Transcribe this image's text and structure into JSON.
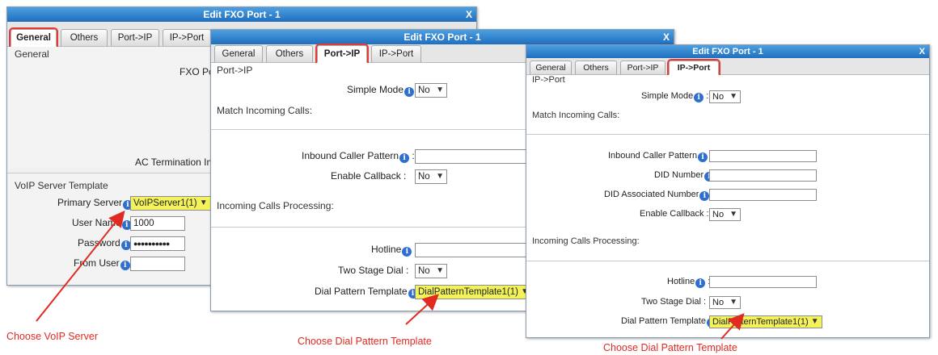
{
  "dialog1": {
    "title": "Edit FXO Port - 1",
    "close": "X",
    "tabs": [
      {
        "label": "General",
        "active": true
      },
      {
        "label": "Others",
        "active": false
      },
      {
        "label": "Port->IP",
        "active": false
      },
      {
        "label": "IP->Port",
        "active": false
      }
    ],
    "section_general": "General",
    "fxo_label": "FXO Por",
    "ac_label": "AC Termination Imp",
    "section_voip": "VoIP Server Template",
    "primary_server_label": "Primary Server",
    "primary_server_value": "VoIPServer1(1)",
    "username_label": "User Name",
    "username_value": "1000",
    "password_label": "Password",
    "password_value": "●●●●●●●●●●",
    "fromuser_label": "From User",
    "fromuser_value": ""
  },
  "dialog2": {
    "title": "Edit FXO Port - 1",
    "close": "X",
    "tabs": [
      {
        "label": "General",
        "active": false
      },
      {
        "label": "Others",
        "active": false
      },
      {
        "label": "Port->IP",
        "active": true
      },
      {
        "label": "IP->Port",
        "active": false
      }
    ],
    "section": "Port->IP",
    "simple_mode_label": "Simple Mode",
    "simple_mode_value": "No",
    "match_incoming": "Match Incoming Calls:",
    "inbound_caller_label": "Inbound Caller Pattern",
    "inbound_caller_value": "",
    "enable_callback_label": "Enable Callback :",
    "enable_callback_value": "No",
    "incoming_processing": "Incoming Calls Processing:",
    "hotline_label": "Hotline",
    "hotline_value": "",
    "two_stage_label": "Two Stage Dial :",
    "two_stage_value": "No",
    "dial_pattern_label": "Dial Pattern Template",
    "dial_pattern_value": "DialPatternTemplate1(1)"
  },
  "dialog3": {
    "title": "Edit FXO Port - 1",
    "close": "X",
    "tabs": [
      {
        "label": "General",
        "active": false
      },
      {
        "label": "Others",
        "active": false
      },
      {
        "label": "Port->IP",
        "active": false
      },
      {
        "label": "IP->Port",
        "active": true
      }
    ],
    "section": "IP->Port",
    "simple_mode_label": "Simple Mode",
    "simple_mode_value": "No",
    "match_incoming": "Match Incoming Calls:",
    "inbound_caller_label": "Inbound Caller Pattern",
    "did_number_label": "DID Number",
    "did_assoc_label": "DID Associated Number",
    "enable_callback_label": "Enable Callback :",
    "enable_callback_value": "No",
    "incoming_processing": "Incoming Calls Processing:",
    "hotline_label": "Hotline",
    "two_stage_label": "Two Stage Dial :",
    "two_stage_value": "No",
    "dial_pattern_label": "Dial Pattern Template",
    "dial_pattern_value": "DialPatternTemplate1(1)"
  },
  "annotations": {
    "voip": "Choose VoIP Server",
    "dial1": "Choose Dial Pattern Template",
    "dial2": "Choose Dial Pattern Template"
  },
  "colors": {
    "titlebar": "#2a7fd0",
    "highlight_outline": "#e53935",
    "annotation": "#e02a22",
    "selected_field": "#f3f25a"
  }
}
